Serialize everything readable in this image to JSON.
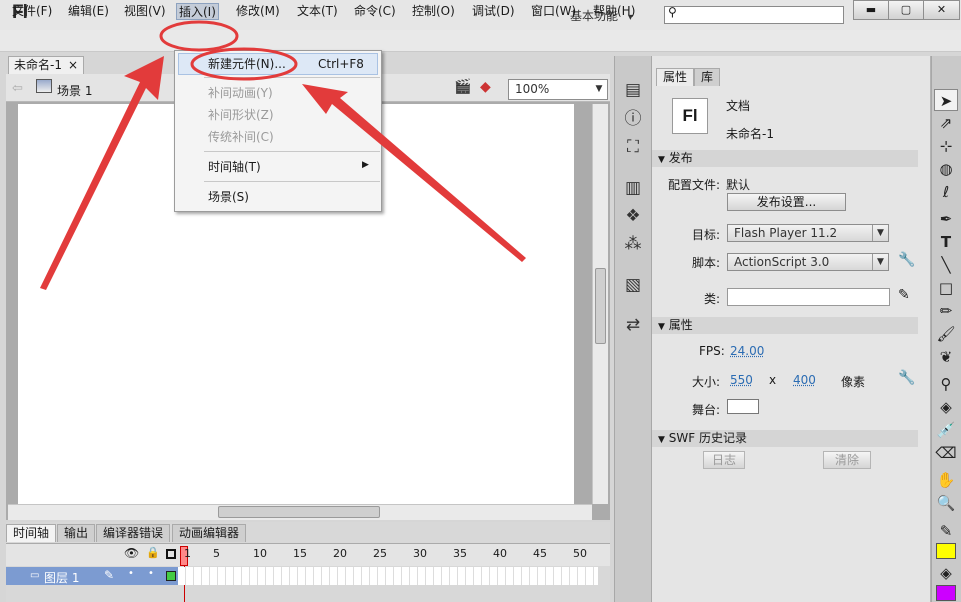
{
  "app": {
    "logo": "Fl",
    "workspace": "基本功能",
    "workspace_arrow": "▾",
    "search_icon": "⚲",
    "min": "▬",
    "max": "▢",
    "close": "✕"
  },
  "menubar": [
    "文件(F)",
    "编辑(E)",
    "视图(V)",
    "插入(I)",
    "修改(M)",
    "文本(T)",
    "命令(C)",
    "控制(O)",
    "调试(D)",
    "窗口(W)",
    "帮助(H)"
  ],
  "document": {
    "tab": "未命名-1",
    "tab_close": "×",
    "scene": "场景 1",
    "zoom": "100%"
  },
  "insert_menu": {
    "new_symbol": "新建元件(N)...",
    "new_symbol_shortcut": "Ctrl+F8",
    "motion_tween": "补间动画(Y)",
    "shape_tween": "补间形状(Z)",
    "classic_tween": "传统补间(C)",
    "timeline": "时间轴(T)",
    "scene": "场景(S)"
  },
  "timeline": {
    "tabs": [
      "时间轴",
      "输出",
      "编译器错误",
      "动画编辑器"
    ],
    "frames": [
      "1",
      "5",
      "10",
      "15",
      "20",
      "25",
      "30",
      "35",
      "40",
      "45",
      "50"
    ],
    "layer": "图层 1"
  },
  "properties": {
    "tabs": [
      "属性",
      "库"
    ],
    "doc_type": "文档",
    "doc_name": "未命名-1",
    "doc_icon": "Fl",
    "publish_header": "发布",
    "profile_label": "配置文件:",
    "profile_value": "默认",
    "publish_settings": "发布设置...",
    "target_label": "目标:",
    "target_value": "Flash Player 11.2",
    "script_label": "脚本:",
    "script_value": "ActionScript 3.0",
    "class_label": "类:",
    "props_header": "属性",
    "fps_label": "FPS:",
    "fps_value": "24.00",
    "size_label": "大小:",
    "width": "550",
    "x": "x",
    "height": "400",
    "unit": "像素",
    "stage_label": "舞台:",
    "swf_header": "SWF 历史记录",
    "log_button": "日志",
    "clear_button": "清除"
  },
  "colors": {
    "accent_red": "#e23b3b",
    "stage_swatch": "#ffffff",
    "stroke_color": "#222222",
    "fill_color": "#ffff00",
    "fill_swatch_2": "#cc00ff"
  }
}
